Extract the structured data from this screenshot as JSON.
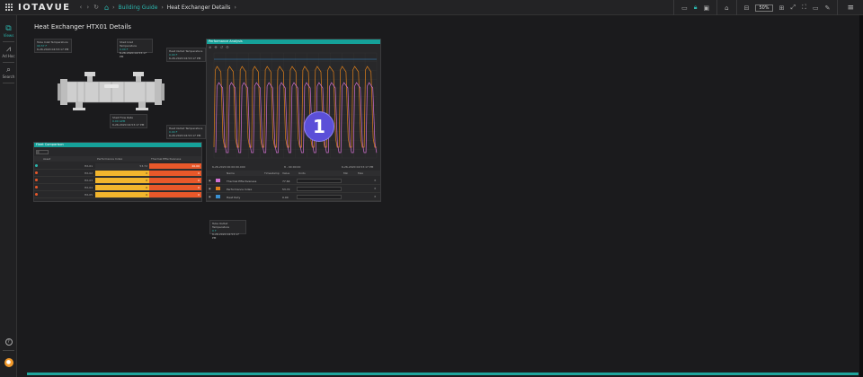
{
  "app": {
    "logo_text": "IOTAVUE"
  },
  "breadcrumb": {
    "link": "Building Guide",
    "current": "Heat Exchanger Details"
  },
  "toolbar": {
    "zoom_value": "50%"
  },
  "sidebar": {
    "items": [
      {
        "label": "Views",
        "icon": "views-icon"
      },
      {
        "label": "Ad Hoc",
        "icon": "chart-icon"
      },
      {
        "label": "Search",
        "icon": "search-icon"
      }
    ]
  },
  "page": {
    "title": "Heat Exchanger HTX01 Details"
  },
  "tagcards": [
    {
      "label": "Tube Inlet Temperature",
      "value": "90.57 F",
      "time": "6-26-2020 04:53:17 PM"
    },
    {
      "label": "Shell Inlet Temperature",
      "value": "0.00 F",
      "time": "6-26-2020 04:53:17 PM"
    },
    {
      "label": "Heat Outlet Temperature",
      "value": "0.00 F",
      "time": "6-26-2020 04:53:17 PM"
    },
    {
      "label": "Shell Flow Rate",
      "value": "0.00 GPM",
      "time": "6-26-2020 04:53:17 PM"
    },
    {
      "label": "Heat Outlet Temperature",
      "value": "0.00 F",
      "time": "6-26-2020 04:53:17 PM"
    },
    {
      "label": "Tube Outlet Temperature",
      "value": "0 F",
      "time": "6-26-2020 04:53:17 PM"
    }
  ],
  "fleet": {
    "title": "Fleet Comparison",
    "columns": [
      "Asset",
      "Performance Index",
      "Thermal Effectiveness"
    ],
    "rows": [
      {
        "asset": "HX-01",
        "perf": "53.72",
        "thermal": "40.00"
      },
      {
        "asset": "HX-02",
        "perf": "0",
        "thermal": "0"
      },
      {
        "asset": "HX-03",
        "perf": "0",
        "thermal": "0"
      },
      {
        "asset": "HX-04",
        "perf": "0",
        "thermal": "0"
      },
      {
        "asset": "HX-05",
        "perf": "0",
        "thermal": "0"
      }
    ]
  },
  "trend": {
    "title": "Performance Analysis",
    "start": "6-26-2020 00:00:00.000",
    "mid": "8 - 00:00:00",
    "end": "6-26-2020 04:53:17 PM",
    "legend_headers": [
      "Name",
      "Timestamp",
      "Value",
      "Units",
      "Min",
      "Max"
    ],
    "legend": [
      {
        "name": "Thermal Effectiveness",
        "value": "77.64",
        "color": "#d070d0"
      },
      {
        "name": "Performance Index",
        "value": "53.72",
        "color": "#e0801a"
      },
      {
        "name": "Heat Duty",
        "value": "0.00",
        "color": "#3a90d0"
      }
    ]
  },
  "badge": {
    "number": "1"
  },
  "colors": {
    "accent": "#2bb5ad",
    "header": "#15a29a",
    "perf_fill": "#f2b52d",
    "thermal_fill": "#e8582a",
    "badge": "#5b4fd8"
  }
}
